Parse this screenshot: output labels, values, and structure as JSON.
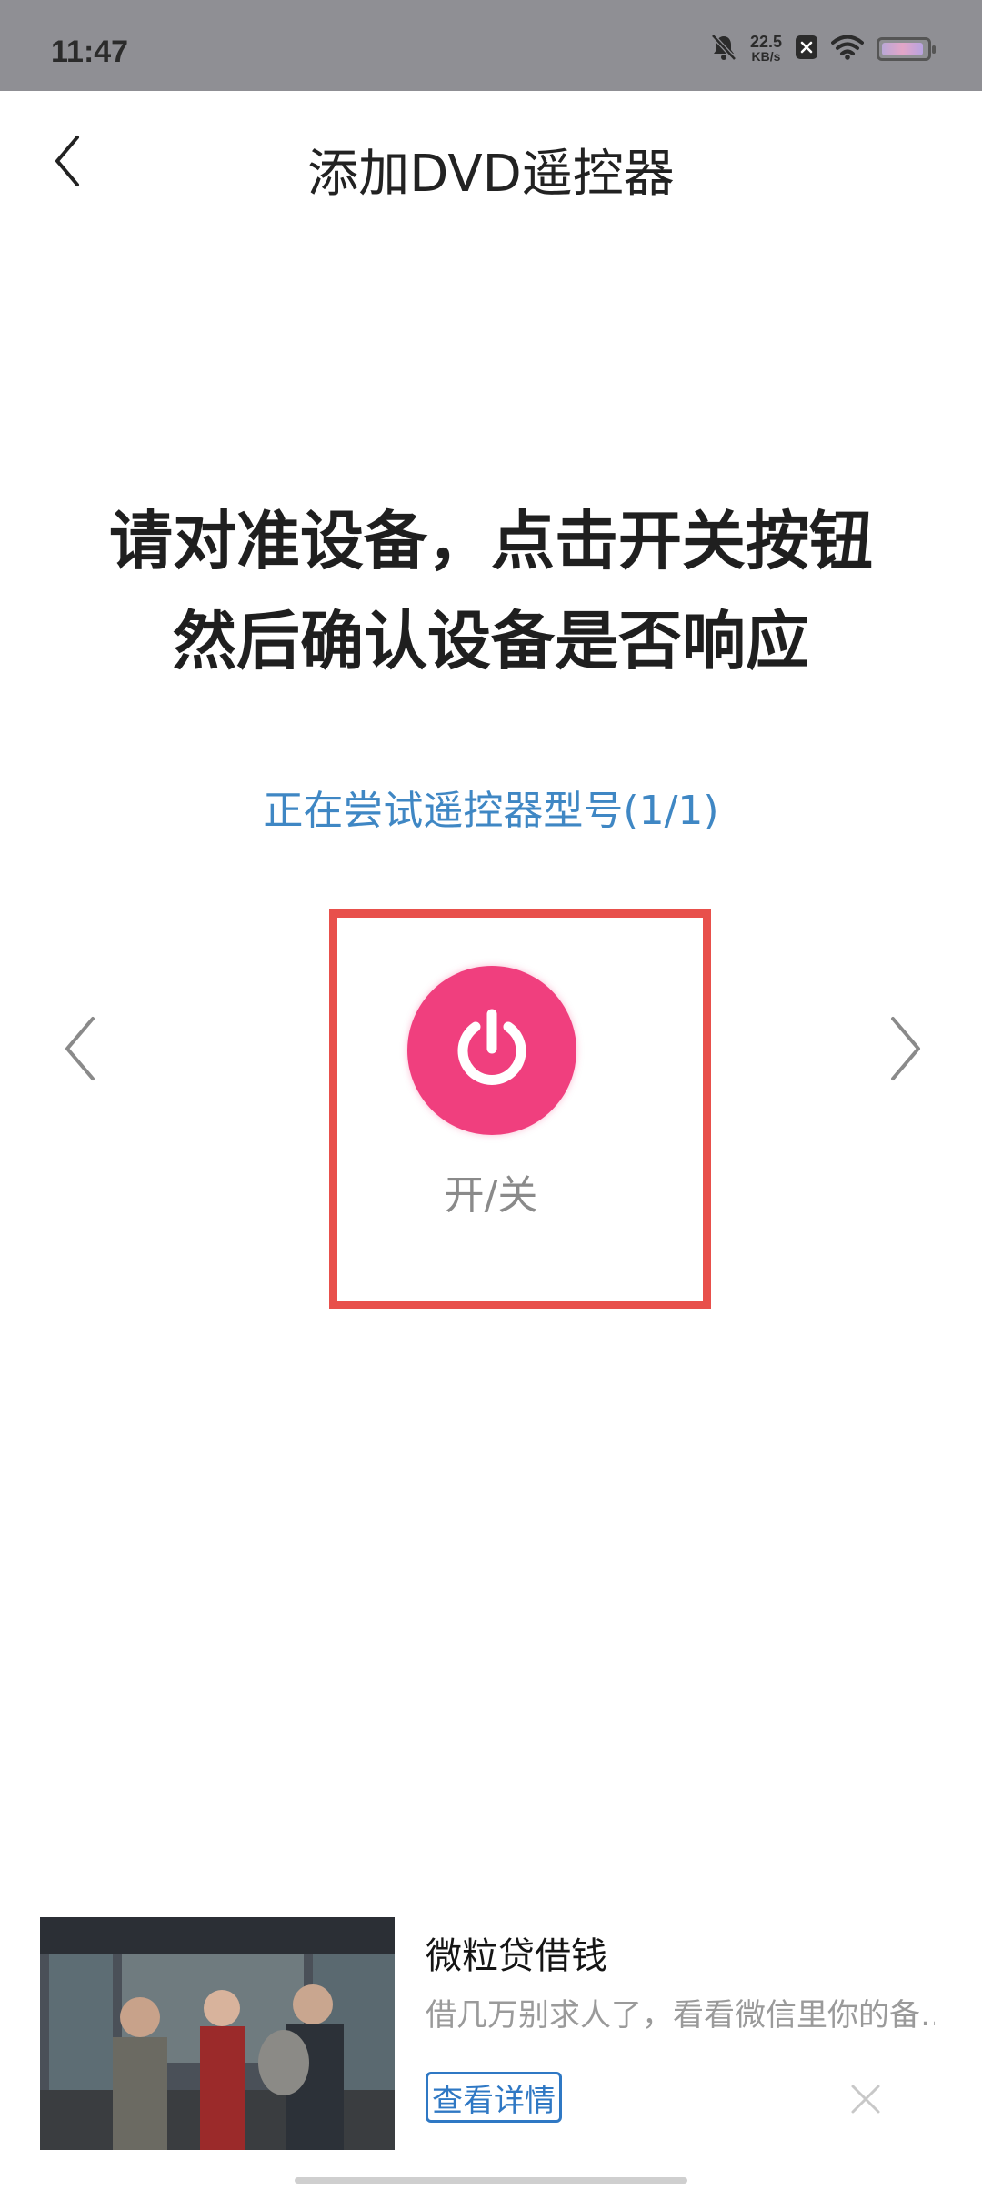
{
  "status_bar": {
    "time": "11:47",
    "speed_value": "22.5",
    "speed_unit": "KB/s",
    "icons": [
      "bell-off-icon",
      "notification-x-icon",
      "wifi-icon",
      "battery-icon"
    ]
  },
  "nav": {
    "title": "添加DVD遥控器",
    "back_icon": "chevron-left-icon"
  },
  "instruction": {
    "line1": "请对准设备，点击开关按钮",
    "line2": "然后确认设备是否响应"
  },
  "trying_text": "正在尝试遥控器型号(1/1)",
  "remote": {
    "power_label": "开/关",
    "power_color": "#f03f7e",
    "highlight_color": "#e8504b",
    "prev_icon": "chevron-left-icon",
    "next_icon": "chevron-right-icon"
  },
  "ad": {
    "title": "微粒贷借钱",
    "description": "借几万别求人了，看看微信里你的备…",
    "button_label": "查看详情",
    "close_icon": "close-icon"
  }
}
